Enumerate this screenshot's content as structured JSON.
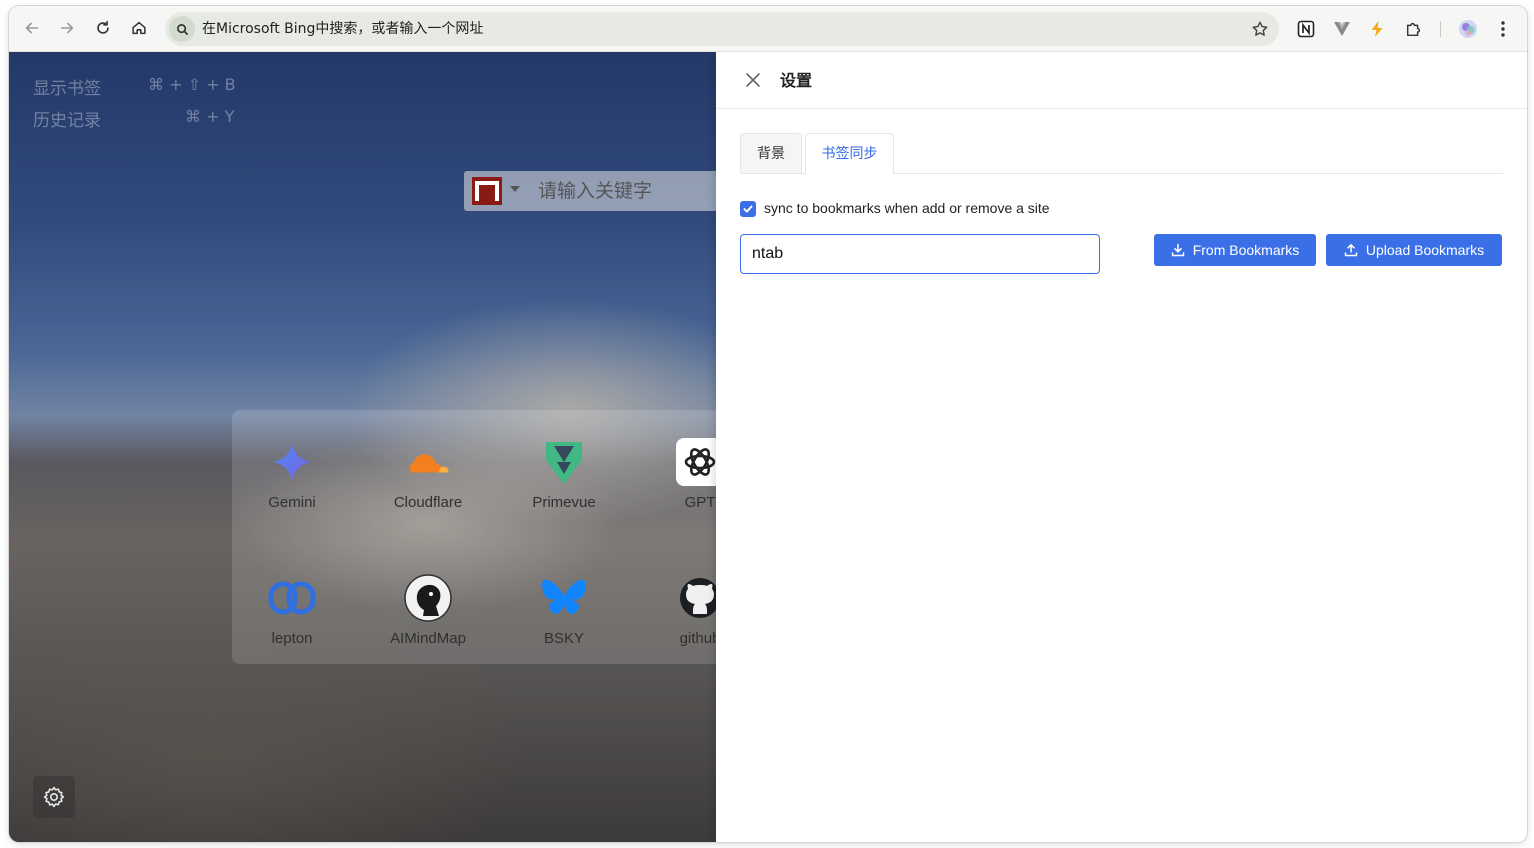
{
  "browser": {
    "address_placeholder": "在Microsoft Bing中搜索，或者输入一个网址",
    "icons": [
      "back-icon",
      "forward-icon",
      "reload-icon",
      "home-icon",
      "search-icon",
      "star-icon",
      "notion-extension-icon",
      "vue-devtools-icon",
      "lightning-extension-icon",
      "puzzle-extensions-icon",
      "profile-avatar-icon",
      "more-menu-icon"
    ]
  },
  "newtab": {
    "shortcuts": [
      {
        "label": "显示书签",
        "key": "⌘ + ⇧ + B"
      },
      {
        "label": "历史记录",
        "key": "⌘ + Y"
      }
    ],
    "search_placeholder": "请输入关键字",
    "sites": [
      {
        "label": "Gemini",
        "icon": "gemini-icon"
      },
      {
        "label": "Cloudflare",
        "icon": "cloudflare-icon"
      },
      {
        "label": "Primevue",
        "icon": "primevue-icon"
      },
      {
        "label": "GPT",
        "icon": "openai-icon"
      },
      {
        "label": "lepton",
        "icon": "lepton-icon"
      },
      {
        "label": "AIMindMap",
        "icon": "aimindmap-icon"
      },
      {
        "label": "BSKY",
        "icon": "bluesky-icon"
      },
      {
        "label": "github",
        "icon": "github-icon"
      }
    ]
  },
  "settings": {
    "title": "设置",
    "tabs": [
      {
        "label": "背景",
        "active": false
      },
      {
        "label": "书签同步",
        "active": true
      }
    ],
    "sync_checkbox_label": "sync to bookmarks when add or remove a site",
    "sync_checked": true,
    "folder_input_value": "ntab",
    "from_bookmarks_label": "From Bookmarks",
    "upload_bookmarks_label": "Upload Bookmarks"
  },
  "colors": {
    "accent": "#3b6fe8",
    "active_tab_text": "#3366e6"
  }
}
